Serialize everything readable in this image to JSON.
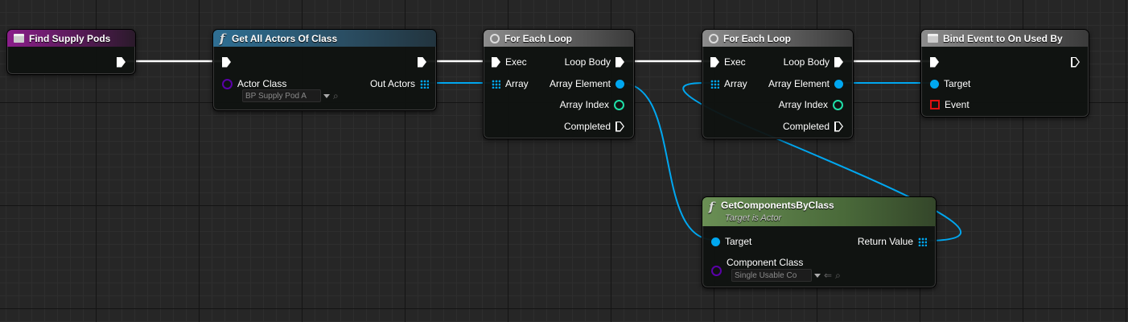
{
  "nodes": {
    "find_supply_pods": {
      "title": "Find Supply Pods"
    },
    "get_all_actors": {
      "title": "Get All Actors Of Class",
      "actor_class_label": "Actor Class",
      "actor_class_value": "BP Supply Pod A",
      "out_actors_label": "Out Actors"
    },
    "for_each_1": {
      "title": "For Each Loop",
      "exec_label": "Exec",
      "array_label": "Array",
      "loop_body_label": "Loop Body",
      "array_element_label": "Array Element",
      "array_index_label": "Array Index",
      "completed_label": "Completed"
    },
    "for_each_2": {
      "title": "For Each Loop",
      "exec_label": "Exec",
      "array_label": "Array",
      "loop_body_label": "Loop Body",
      "array_element_label": "Array Element",
      "array_index_label": "Array Index",
      "completed_label": "Completed"
    },
    "bind_event": {
      "title": "Bind Event to On Used By",
      "target_label": "Target",
      "event_label": "Event"
    },
    "get_components": {
      "title": "GetComponentsByClass",
      "subtitle": "Target is Actor",
      "target_label": "Target",
      "return_value_label": "Return Value",
      "component_class_label": "Component Class",
      "component_class_value": "Single Usable Co"
    }
  },
  "icons": {
    "event": "event-node-icon",
    "function": "function-f-icon",
    "loop": "loop-macro-icon"
  },
  "colors": {
    "event_header": "#8a1e8a",
    "function_header": "#2f6f93",
    "loop_header": "#8c8c8c",
    "pure_function_header": "#6a8f55",
    "object_wire": "#00a7f0",
    "exec_wire": "#ffffff",
    "class_pin": "#5a00a8",
    "int_pin": "#1fe0a8",
    "delegate_pin": "#e01010"
  }
}
